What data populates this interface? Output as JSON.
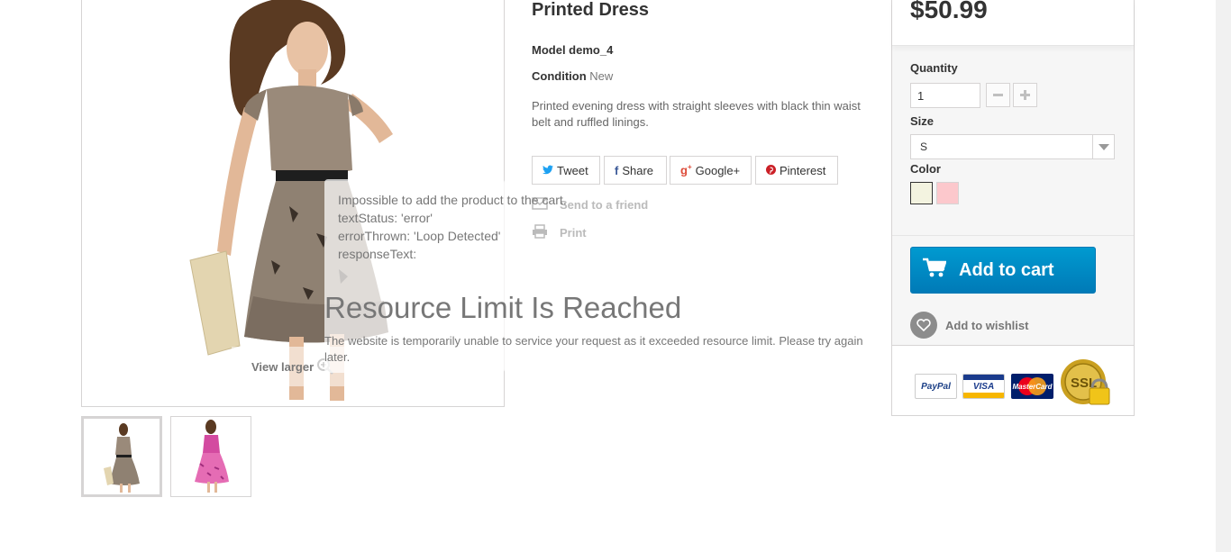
{
  "product": {
    "title": "Printed Dress",
    "model": "Model demo_4",
    "condition_label": "Condition",
    "condition_value": "New",
    "description": "Printed evening dress with straight sleeves with black thin waist belt and ruffled linings."
  },
  "gallery": {
    "view_larger": "View larger"
  },
  "social": {
    "tweet": "Tweet",
    "share": "Share",
    "google": "Google+",
    "pinterest": "Pinterest"
  },
  "links": {
    "send_friend": "Send to a friend",
    "print": "Print"
  },
  "error": {
    "line1": "Impossible to add the product to the cart.",
    "line2": "textStatus: 'error'",
    "line3": "errorThrown: 'Loop Detected'",
    "line4": "responseText:",
    "heading": "Resource Limit Is Reached",
    "body": "The website is temporarily unable to service your request as it exceeded resource limit. Please try again later."
  },
  "buy_box": {
    "price": "$50.99",
    "quantity_label": "Quantity",
    "quantity_value": "1",
    "size_label": "Size",
    "size_value": "S",
    "color_label": "Color",
    "colors": [
      "#f3f3e0",
      "#fcc8cc"
    ],
    "add_to_cart": "Add to cart",
    "wishlist": "Add to wishlist",
    "payment_logos": [
      "PayPal",
      "VISA",
      "MasterCard",
      "SSL"
    ]
  }
}
